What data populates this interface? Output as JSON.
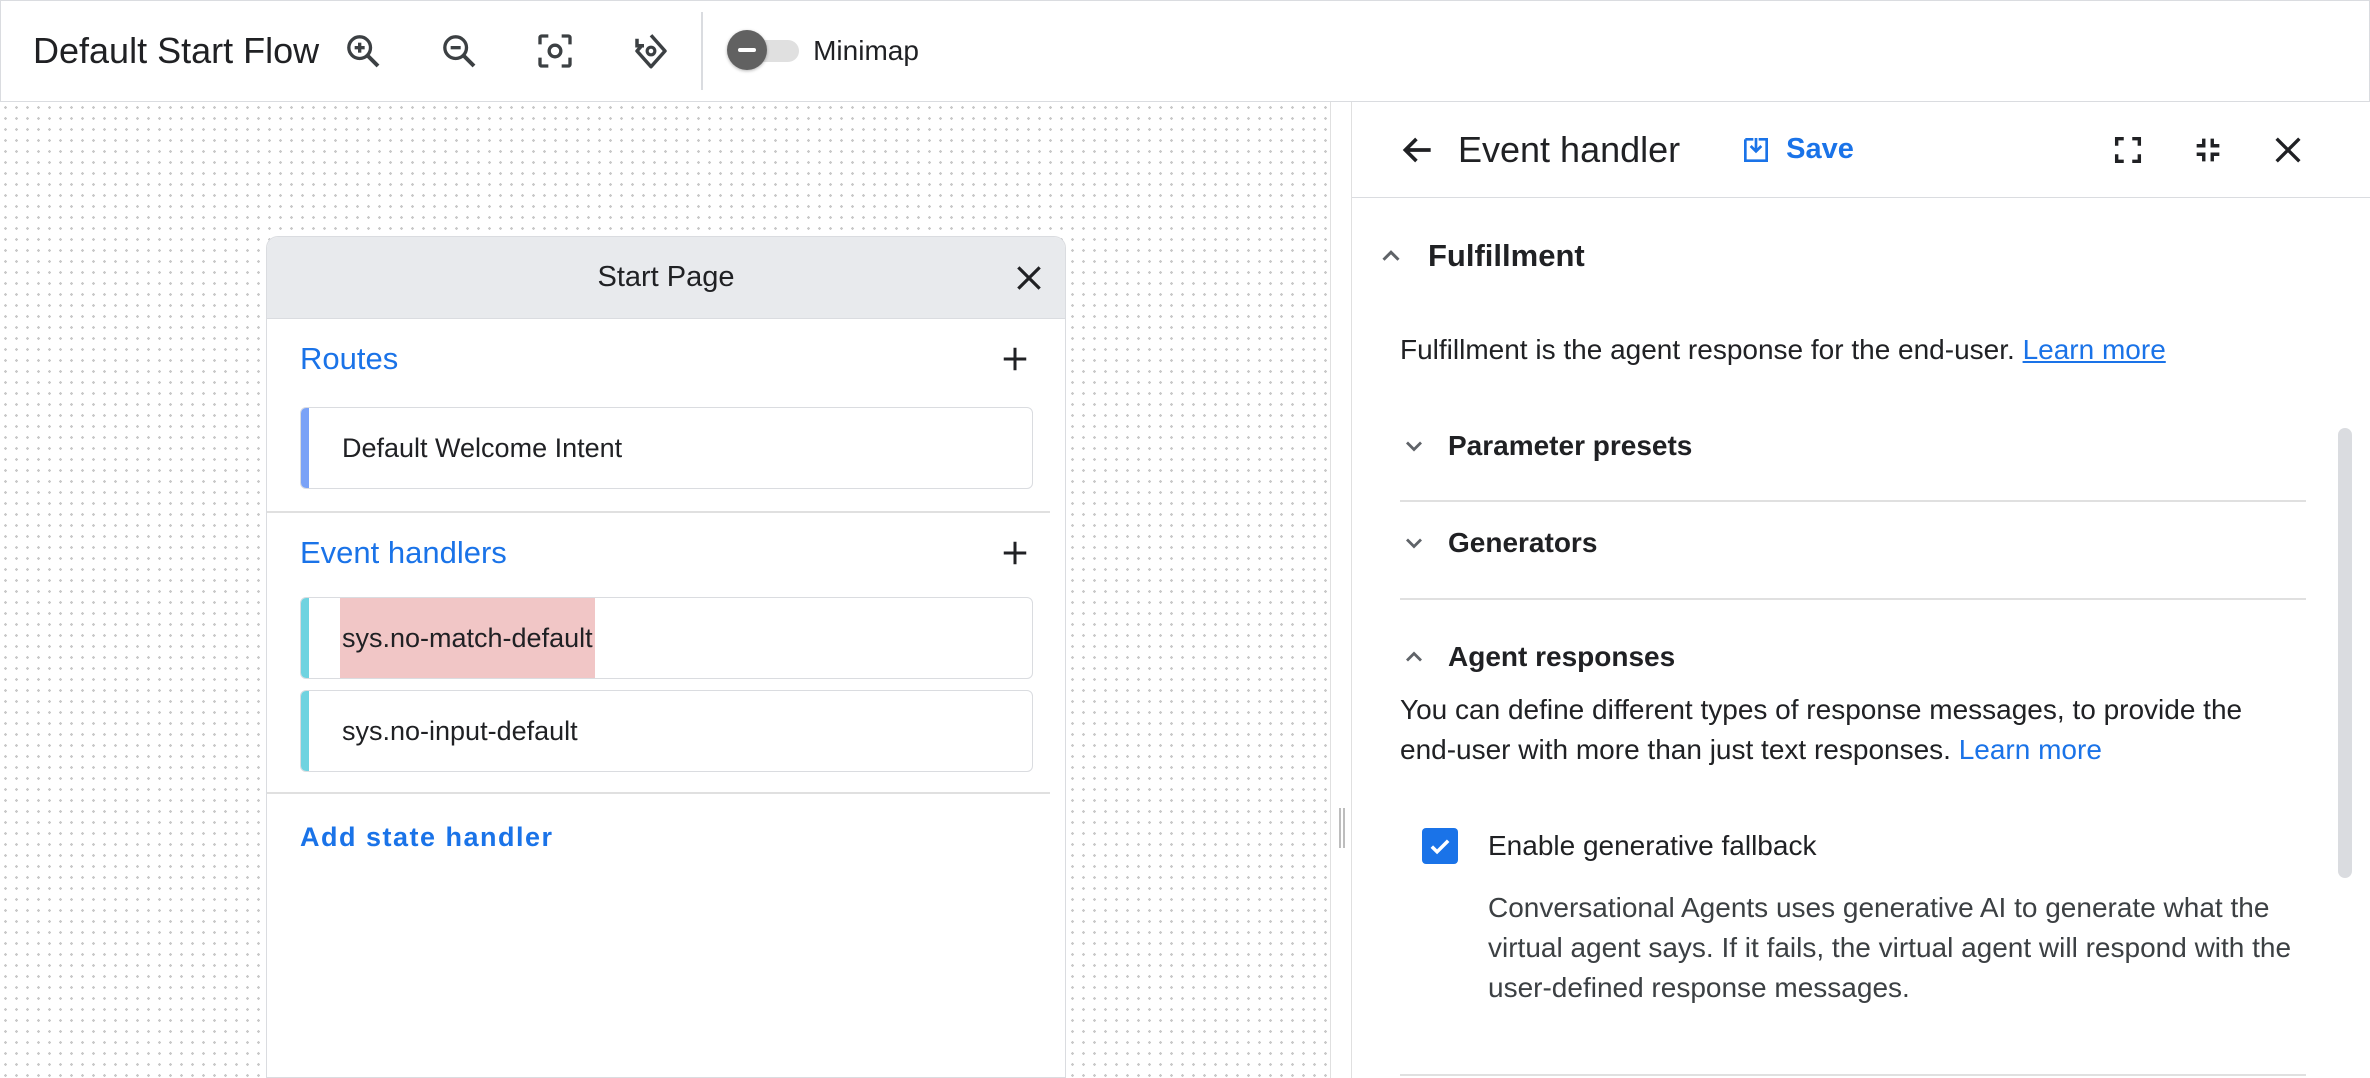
{
  "toolbar": {
    "title": "Default Start Flow",
    "minimap_label": "Minimap",
    "icons": [
      "zoom-in-icon",
      "zoom-out-icon",
      "fit-view-icon",
      "reset-rotate-icon"
    ]
  },
  "page_card": {
    "title": "Start Page",
    "routes": {
      "title": "Routes",
      "items": [
        {
          "label": "Default Welcome Intent"
        }
      ]
    },
    "event_handlers": {
      "title": "Event handlers",
      "items": [
        {
          "label": "sys.no-match-default",
          "selected": true
        },
        {
          "label": "sys.no-input-default",
          "selected": false
        }
      ]
    },
    "add_state_handler": "Add state handler"
  },
  "panel": {
    "title": "Event handler",
    "save_label": "Save",
    "fulfillment": {
      "title": "Fulfillment",
      "description": "Fulfillment is the agent response for the end-user.",
      "learn_more": "Learn more"
    },
    "sections": [
      {
        "title": "Parameter presets",
        "expanded": false
      },
      {
        "title": "Generators",
        "expanded": false
      },
      {
        "title": "Agent responses",
        "expanded": true
      }
    ],
    "agent_responses": {
      "description": "You can define different types of response messages, to provide the end-user with more than just text responses.",
      "learn_more": "Learn more",
      "generative_fallback": {
        "label": "Enable generative fallback",
        "checked": true,
        "description": "Conversational Agents uses generative AI to generate what the virtual agent says. If it fails, the virtual agent will respond with the user-defined response messages."
      }
    }
  },
  "colors": {
    "accent": "#1a73e8",
    "route_bar": "#7aa2f7",
    "event_bar": "#6fd3e0",
    "selected_highlight": "#f1c6c6"
  }
}
